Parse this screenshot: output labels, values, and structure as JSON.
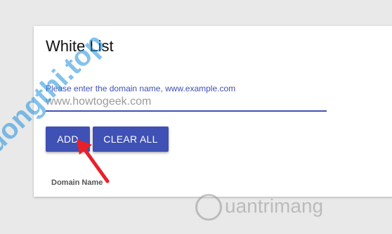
{
  "card": {
    "title": "White List",
    "domain_field": {
      "label": "Please enter the domain name, www.example.com",
      "value": "www.howtogeek.com"
    },
    "buttons": {
      "add_label": "ADD",
      "clear_all_label": "CLEAR ALL"
    },
    "table": {
      "column_header": "Domain Name"
    }
  },
  "watermarks": {
    "left": "Truongthi.top",
    "right": "uantrimang"
  },
  "colors": {
    "accent": "#3f51b5",
    "annotation_arrow": "#e8202a"
  }
}
